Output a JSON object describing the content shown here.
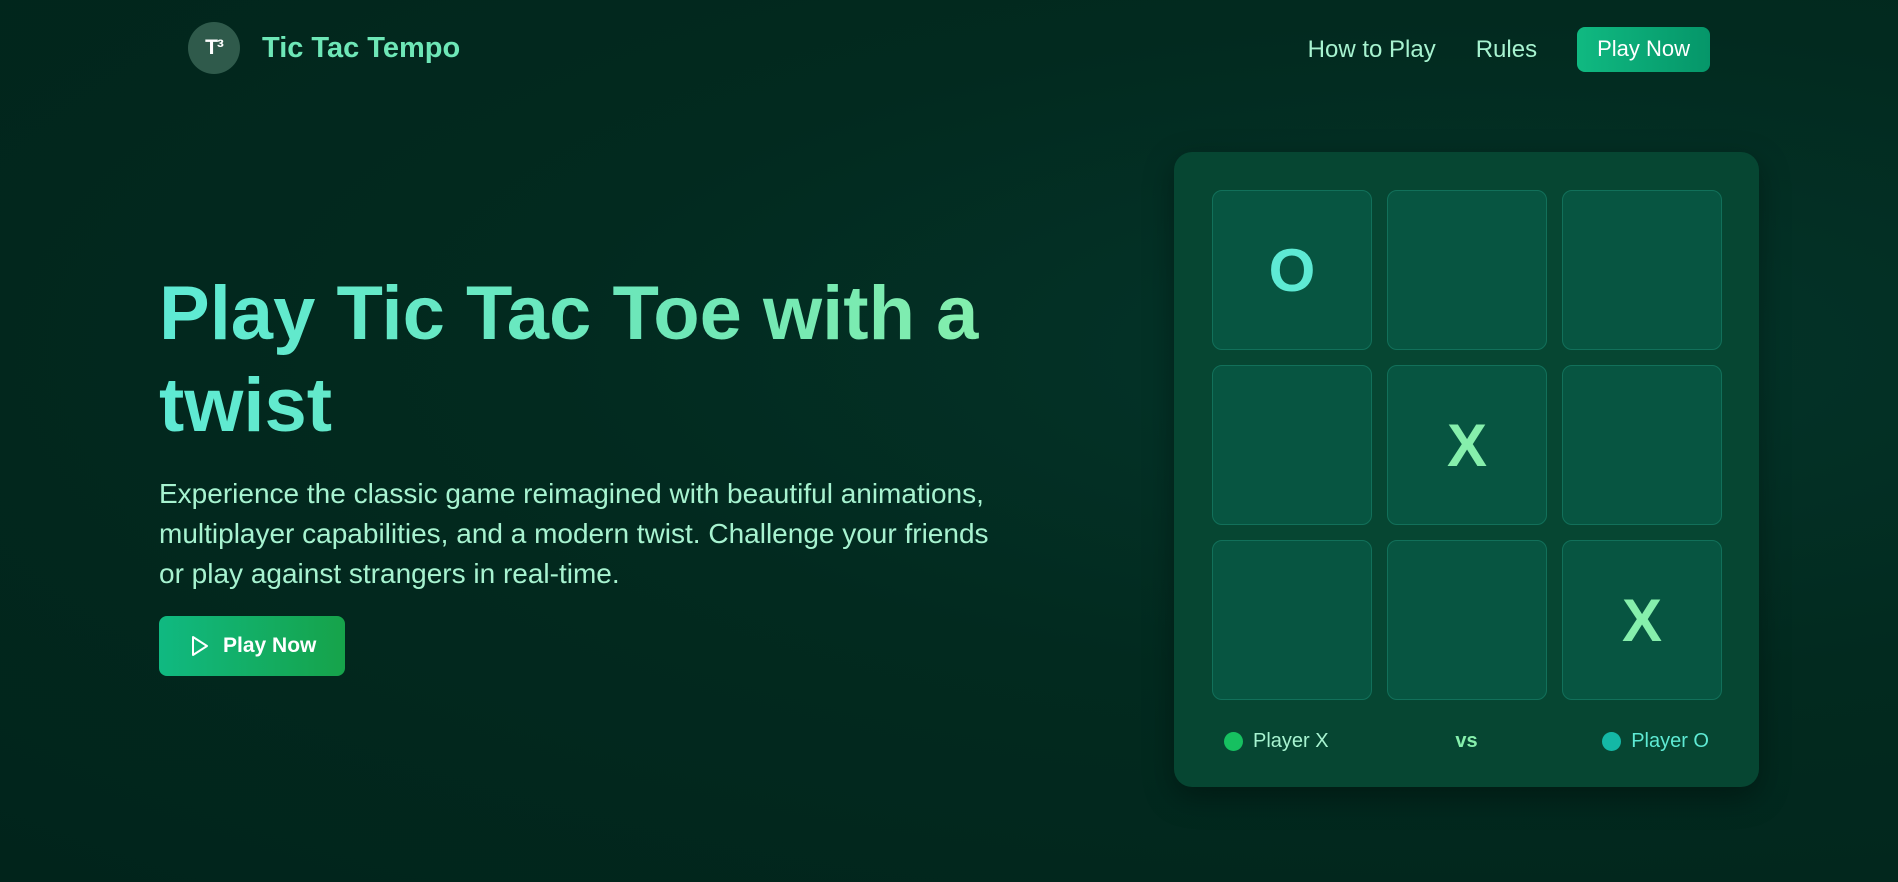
{
  "header": {
    "logo_badge": "T³",
    "logo_text": "Tic Tac Tempo",
    "nav_links": [
      "How to Play",
      "Rules"
    ],
    "cta_label": "Play Now"
  },
  "hero": {
    "title": "Play Tic Tac Toe with a twist",
    "description": "Experience the classic game reimagined with beautiful animations, multiplayer capabilities, and a modern twist. Challenge your friends or play against strangers in real-time.",
    "cta_label": "Play Now",
    "cta_icon": "play-icon"
  },
  "board": {
    "cells": [
      "O",
      "",
      "",
      "",
      "X",
      "",
      "",
      "",
      "X"
    ],
    "player_x": {
      "label": "Player X",
      "color": "#16c060"
    },
    "vs_label": "vs",
    "player_o": {
      "label": "Player O",
      "color": "#14b8a6"
    }
  },
  "colors": {
    "background": "#022a1f",
    "accent": "#10b981",
    "board_card": "#064632",
    "cell": "#075541",
    "heading": "#5eead4",
    "body_text": "#a7f3d0"
  }
}
